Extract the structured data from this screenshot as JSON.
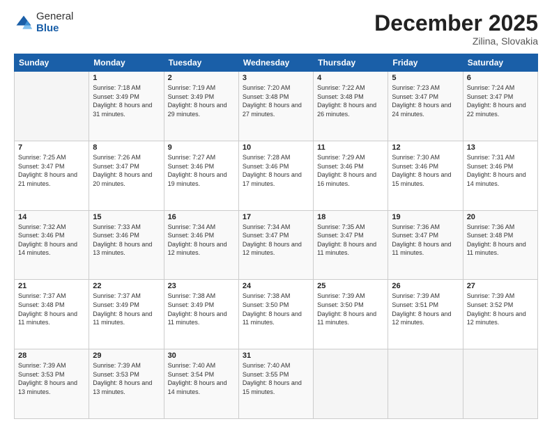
{
  "logo": {
    "general": "General",
    "blue": "Blue"
  },
  "title": "December 2025",
  "subtitle": "Zilina, Slovakia",
  "headers": [
    "Sunday",
    "Monday",
    "Tuesday",
    "Wednesday",
    "Thursday",
    "Friday",
    "Saturday"
  ],
  "weeks": [
    [
      {
        "day": "",
        "sunrise": "",
        "sunset": "",
        "daylight": ""
      },
      {
        "day": "1",
        "sunrise": "Sunrise: 7:18 AM",
        "sunset": "Sunset: 3:49 PM",
        "daylight": "Daylight: 8 hours and 31 minutes."
      },
      {
        "day": "2",
        "sunrise": "Sunrise: 7:19 AM",
        "sunset": "Sunset: 3:49 PM",
        "daylight": "Daylight: 8 hours and 29 minutes."
      },
      {
        "day": "3",
        "sunrise": "Sunrise: 7:20 AM",
        "sunset": "Sunset: 3:48 PM",
        "daylight": "Daylight: 8 hours and 27 minutes."
      },
      {
        "day": "4",
        "sunrise": "Sunrise: 7:22 AM",
        "sunset": "Sunset: 3:48 PM",
        "daylight": "Daylight: 8 hours and 26 minutes."
      },
      {
        "day": "5",
        "sunrise": "Sunrise: 7:23 AM",
        "sunset": "Sunset: 3:47 PM",
        "daylight": "Daylight: 8 hours and 24 minutes."
      },
      {
        "day": "6",
        "sunrise": "Sunrise: 7:24 AM",
        "sunset": "Sunset: 3:47 PM",
        "daylight": "Daylight: 8 hours and 22 minutes."
      }
    ],
    [
      {
        "day": "7",
        "sunrise": "Sunrise: 7:25 AM",
        "sunset": "Sunset: 3:47 PM",
        "daylight": "Daylight: 8 hours and 21 minutes."
      },
      {
        "day": "8",
        "sunrise": "Sunrise: 7:26 AM",
        "sunset": "Sunset: 3:47 PM",
        "daylight": "Daylight: 8 hours and 20 minutes."
      },
      {
        "day": "9",
        "sunrise": "Sunrise: 7:27 AM",
        "sunset": "Sunset: 3:46 PM",
        "daylight": "Daylight: 8 hours and 19 minutes."
      },
      {
        "day": "10",
        "sunrise": "Sunrise: 7:28 AM",
        "sunset": "Sunset: 3:46 PM",
        "daylight": "Daylight: 8 hours and 17 minutes."
      },
      {
        "day": "11",
        "sunrise": "Sunrise: 7:29 AM",
        "sunset": "Sunset: 3:46 PM",
        "daylight": "Daylight: 8 hours and 16 minutes."
      },
      {
        "day": "12",
        "sunrise": "Sunrise: 7:30 AM",
        "sunset": "Sunset: 3:46 PM",
        "daylight": "Daylight: 8 hours and 15 minutes."
      },
      {
        "day": "13",
        "sunrise": "Sunrise: 7:31 AM",
        "sunset": "Sunset: 3:46 PM",
        "daylight": "Daylight: 8 hours and 14 minutes."
      }
    ],
    [
      {
        "day": "14",
        "sunrise": "Sunrise: 7:32 AM",
        "sunset": "Sunset: 3:46 PM",
        "daylight": "Daylight: 8 hours and 14 minutes."
      },
      {
        "day": "15",
        "sunrise": "Sunrise: 7:33 AM",
        "sunset": "Sunset: 3:46 PM",
        "daylight": "Daylight: 8 hours and 13 minutes."
      },
      {
        "day": "16",
        "sunrise": "Sunrise: 7:34 AM",
        "sunset": "Sunset: 3:46 PM",
        "daylight": "Daylight: 8 hours and 12 minutes."
      },
      {
        "day": "17",
        "sunrise": "Sunrise: 7:34 AM",
        "sunset": "Sunset: 3:47 PM",
        "daylight": "Daylight: 8 hours and 12 minutes."
      },
      {
        "day": "18",
        "sunrise": "Sunrise: 7:35 AM",
        "sunset": "Sunset: 3:47 PM",
        "daylight": "Daylight: 8 hours and 11 minutes."
      },
      {
        "day": "19",
        "sunrise": "Sunrise: 7:36 AM",
        "sunset": "Sunset: 3:47 PM",
        "daylight": "Daylight: 8 hours and 11 minutes."
      },
      {
        "day": "20",
        "sunrise": "Sunrise: 7:36 AM",
        "sunset": "Sunset: 3:48 PM",
        "daylight": "Daylight: 8 hours and 11 minutes."
      }
    ],
    [
      {
        "day": "21",
        "sunrise": "Sunrise: 7:37 AM",
        "sunset": "Sunset: 3:48 PM",
        "daylight": "Daylight: 8 hours and 11 minutes."
      },
      {
        "day": "22",
        "sunrise": "Sunrise: 7:37 AM",
        "sunset": "Sunset: 3:49 PM",
        "daylight": "Daylight: 8 hours and 11 minutes."
      },
      {
        "day": "23",
        "sunrise": "Sunrise: 7:38 AM",
        "sunset": "Sunset: 3:49 PM",
        "daylight": "Daylight: 8 hours and 11 minutes."
      },
      {
        "day": "24",
        "sunrise": "Sunrise: 7:38 AM",
        "sunset": "Sunset: 3:50 PM",
        "daylight": "Daylight: 8 hours and 11 minutes."
      },
      {
        "day": "25",
        "sunrise": "Sunrise: 7:39 AM",
        "sunset": "Sunset: 3:50 PM",
        "daylight": "Daylight: 8 hours and 11 minutes."
      },
      {
        "day": "26",
        "sunrise": "Sunrise: 7:39 AM",
        "sunset": "Sunset: 3:51 PM",
        "daylight": "Daylight: 8 hours and 12 minutes."
      },
      {
        "day": "27",
        "sunrise": "Sunrise: 7:39 AM",
        "sunset": "Sunset: 3:52 PM",
        "daylight": "Daylight: 8 hours and 12 minutes."
      }
    ],
    [
      {
        "day": "28",
        "sunrise": "Sunrise: 7:39 AM",
        "sunset": "Sunset: 3:53 PM",
        "daylight": "Daylight: 8 hours and 13 minutes."
      },
      {
        "day": "29",
        "sunrise": "Sunrise: 7:39 AM",
        "sunset": "Sunset: 3:53 PM",
        "daylight": "Daylight: 8 hours and 13 minutes."
      },
      {
        "day": "30",
        "sunrise": "Sunrise: 7:40 AM",
        "sunset": "Sunset: 3:54 PM",
        "daylight": "Daylight: 8 hours and 14 minutes."
      },
      {
        "day": "31",
        "sunrise": "Sunrise: 7:40 AM",
        "sunset": "Sunset: 3:55 PM",
        "daylight": "Daylight: 8 hours and 15 minutes."
      },
      {
        "day": "",
        "sunrise": "",
        "sunset": "",
        "daylight": ""
      },
      {
        "day": "",
        "sunrise": "",
        "sunset": "",
        "daylight": ""
      },
      {
        "day": "",
        "sunrise": "",
        "sunset": "",
        "daylight": ""
      }
    ]
  ]
}
